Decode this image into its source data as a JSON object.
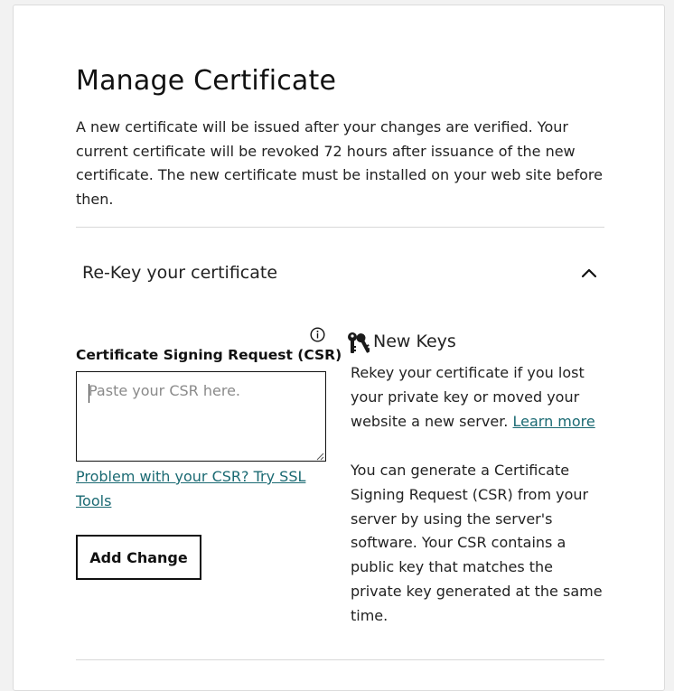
{
  "page": {
    "title": "Manage Certificate",
    "intro": "A new certificate will be issued after your changes are verified. Your current certificate will be revoked 72 hours after issuance of the new certificate. The new certificate must be installed on your web site before then."
  },
  "rekey": {
    "section_title": "Re-Key your certificate",
    "csr_label": "Certificate Signing Request (CSR)",
    "csr_placeholder": "Paste your CSR here.",
    "csr_value": "",
    "csr_help_link": "Problem with your CSR? Try SSL Tools",
    "add_change_label": "Add Change"
  },
  "new_keys": {
    "heading": "New Keys",
    "paragraph1": "Rekey your certificate if you lost your private key or moved your website a new server.",
    "learn_more": "Learn more",
    "paragraph2": "You can generate a Certificate Signing Request (CSR) from your server by using the server's software. Your CSR contains a public key that matches the private key generated at the same time."
  },
  "icons": {
    "chevron": "chevron-up-icon",
    "info": "info-icon",
    "keys": "keys-icon"
  },
  "colors": {
    "link": "#1b6a73",
    "text": "#111111",
    "border": "#111111",
    "divider": "#d8d8d8"
  }
}
